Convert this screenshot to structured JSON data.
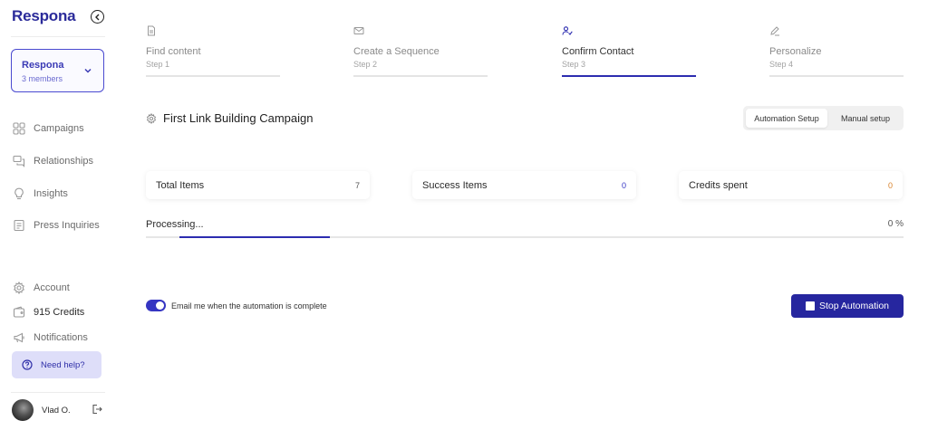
{
  "app": {
    "logo": "Respona"
  },
  "sidebar": {
    "team": {
      "name": "Respona",
      "members": "3 members"
    },
    "nav": [
      {
        "label": "Campaigns",
        "icon": "grid-icon"
      },
      {
        "label": "Relationships",
        "icon": "chat-icon"
      },
      {
        "label": "Insights",
        "icon": "lightbulb-icon"
      },
      {
        "label": "Press Inquiries",
        "icon": "document-icon"
      }
    ],
    "bottom_nav": [
      {
        "label": "Account",
        "icon": "gear-icon"
      },
      {
        "label": "915 Credits",
        "icon": "wallet-icon"
      },
      {
        "label": "Notifications",
        "icon": "megaphone-icon"
      }
    ],
    "help": "Need help?",
    "user": {
      "name": "Vlad O."
    }
  },
  "steps": [
    {
      "title": "Find content",
      "sub": "Step 1",
      "icon": "file-icon",
      "active": false
    },
    {
      "title": "Create a Sequence",
      "sub": "Step 2",
      "icon": "mail-icon",
      "active": false
    },
    {
      "title": "Confirm Contact",
      "sub": "Step 3",
      "icon": "user-check-icon",
      "active": true
    },
    {
      "title": "Personalize",
      "sub": "Step 4",
      "icon": "pen-icon",
      "active": false
    }
  ],
  "campaign": {
    "title": "First Link Building Campaign"
  },
  "mode": {
    "automation": "Automation Setup",
    "manual": "Manual setup",
    "selected": "Automation Setup"
  },
  "stats": {
    "total": {
      "label": "Total Items",
      "value": "7",
      "color": "#555555"
    },
    "success": {
      "label": "Success Items",
      "value": "0",
      "color": "#3434c4"
    },
    "credits": {
      "label": "Credits spent",
      "value": "0",
      "color": "#d9822b"
    }
  },
  "progress": {
    "label": "Processing...",
    "percent": "0 %"
  },
  "email_toggle": {
    "label": "Email me when the automation is complete",
    "on": true
  },
  "stop_button": {
    "label": "Stop Automation"
  }
}
